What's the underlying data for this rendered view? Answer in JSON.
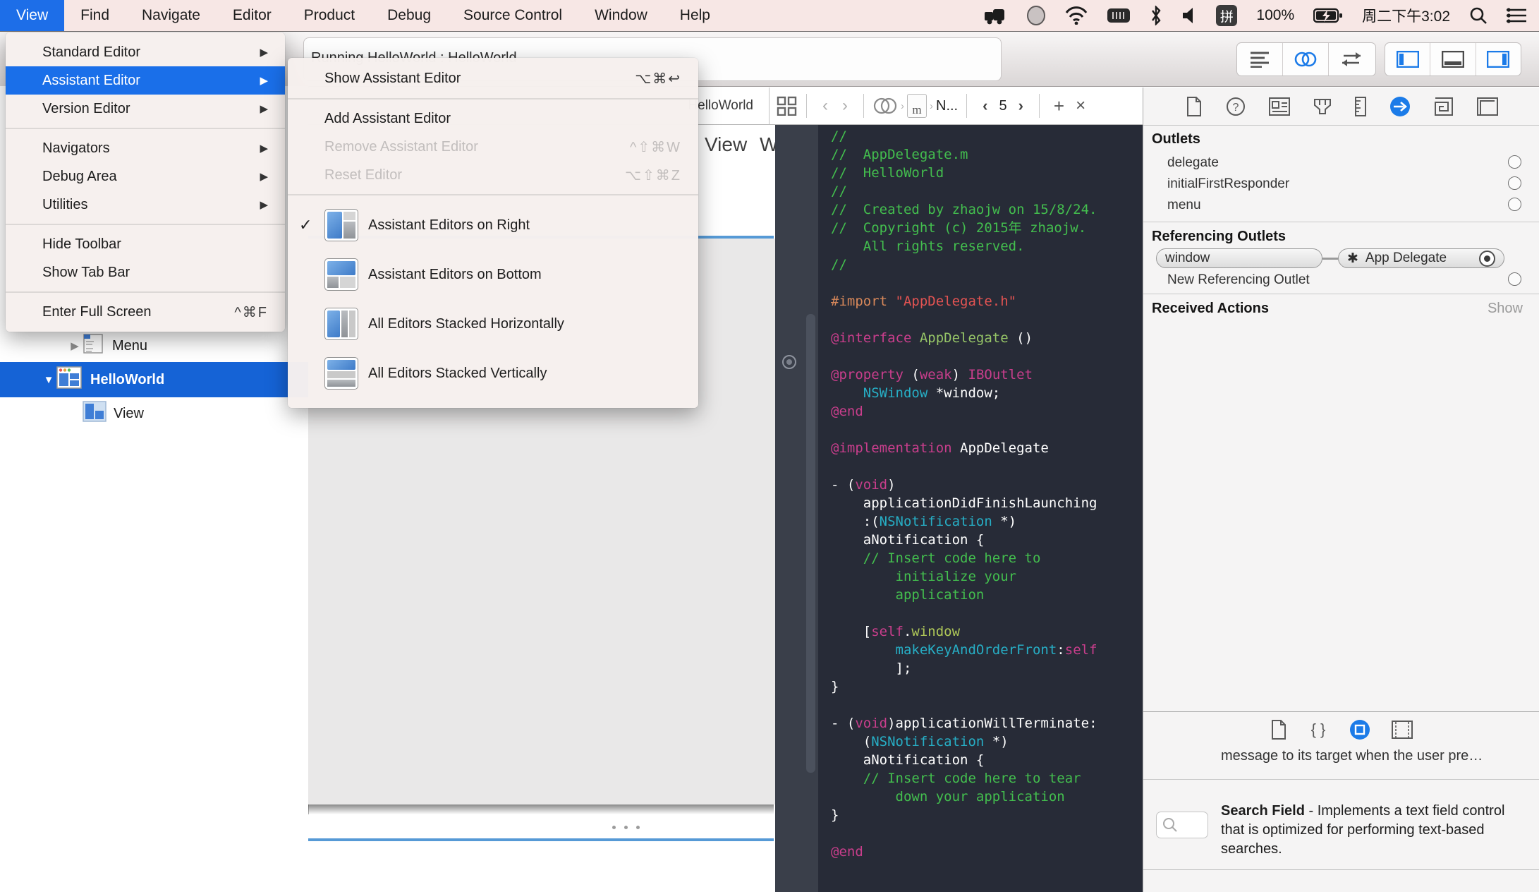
{
  "menubar": {
    "active_menu": "View",
    "menus": [
      "View",
      "Find",
      "Navigate",
      "Editor",
      "Product",
      "Debug",
      "Source Control",
      "Window",
      "Help"
    ],
    "status": {
      "input_method": "拼",
      "battery_percent": "100%",
      "clock": "周二下午3:02"
    }
  },
  "view_menu": {
    "items": [
      {
        "label": "Standard Editor",
        "submenu": true
      },
      {
        "label": "Assistant Editor",
        "submenu": true,
        "highlighted": true
      },
      {
        "label": "Version Editor",
        "submenu": true
      },
      {
        "sep": true
      },
      {
        "label": "Navigators",
        "submenu": true
      },
      {
        "label": "Debug Area",
        "submenu": true
      },
      {
        "label": "Utilities",
        "submenu": true
      },
      {
        "sep": true
      },
      {
        "label": "Hide Toolbar"
      },
      {
        "label": "Show Tab Bar"
      },
      {
        "sep": true
      },
      {
        "label": "Enter Full Screen",
        "shortcut": "^⌘F"
      }
    ]
  },
  "assistant_submenu": {
    "items": [
      {
        "label": "Show Assistant Editor",
        "shortcut": "⌥⌘↩"
      },
      {
        "sep": true
      },
      {
        "label": "Add Assistant Editor"
      },
      {
        "label": "Remove Assistant Editor",
        "shortcut": "^⇧⌘W",
        "disabled": true
      },
      {
        "label": "Reset Editor",
        "shortcut": "⌥⇧⌘Z",
        "disabled": true
      },
      {
        "sep": true
      },
      {
        "label": "Assistant Editors on Right",
        "checked": true,
        "icon": "right"
      },
      {
        "label": "Assistant Editors on Bottom",
        "icon": "bottom"
      },
      {
        "label": "All Editors Stacked Horizontally",
        "icon": "horizontal"
      },
      {
        "label": "All Editors Stacked Vertically",
        "icon": "vertical"
      }
    ]
  },
  "toolbar": {
    "activity_text": "Running HelloWorld : HelloWorld"
  },
  "outline": {
    "rows": [
      {
        "label": "Menu",
        "disclosure": "▶",
        "icon": "menu",
        "indent": 1
      },
      {
        "label": "HelloWorld",
        "disclosure": "▼",
        "icon": "window",
        "selected": true,
        "indent": 0
      },
      {
        "label": "View",
        "disclosure": "",
        "icon": "view",
        "indent": 1
      }
    ]
  },
  "canvas": {
    "header_title": "View",
    "header_partial": "W"
  },
  "primary_jumpbar": {
    "trail": "HelloWorld"
  },
  "assistant_jumpbar": {
    "file_badge": "m",
    "trail": "N...",
    "counter": "5"
  },
  "code_editor": {
    "lines": [
      [
        [
          "cm",
          "//"
        ]
      ],
      [
        [
          "cm",
          "//  AppDelegate.m"
        ]
      ],
      [
        [
          "cm",
          "//  HelloWorld"
        ]
      ],
      [
        [
          "cm",
          "//"
        ]
      ],
      [
        [
          "cm",
          "//  Created by zhaojw on 15/8/24."
        ]
      ],
      [
        [
          "cm",
          "//  Copyright (c) 2015年 zhaojw."
        ]
      ],
      [
        [
          "cm",
          "    All rights reserved."
        ]
      ],
      [
        [
          "cm",
          "//"
        ]
      ],
      [],
      [
        [
          "pp",
          "#import"
        ],
        [
          "pl",
          " "
        ],
        [
          "st",
          "\"AppDelegate.h\""
        ]
      ],
      [],
      [
        [
          "kw",
          "@interface"
        ],
        [
          "pl",
          " "
        ],
        [
          "cls",
          "AppDelegate"
        ],
        [
          "pl",
          " ()"
        ]
      ],
      [],
      [
        [
          "kw",
          "@property"
        ],
        [
          "pl",
          " ("
        ],
        [
          "kw",
          "weak"
        ],
        [
          "pl",
          ") "
        ],
        [
          "kw",
          "IBOutlet"
        ]
      ],
      [
        [
          "pl",
          "    "
        ],
        [
          "ty",
          "NSWindow"
        ],
        [
          "pl",
          " *window;"
        ]
      ],
      [
        [
          "kw",
          "@end"
        ]
      ],
      [],
      [
        [
          "kw",
          "@implementation"
        ],
        [
          "pl",
          " AppDelegate"
        ]
      ],
      [],
      [
        [
          "pl",
          "- ("
        ],
        [
          "kw",
          "void"
        ],
        [
          "pl",
          ")"
        ]
      ],
      [
        [
          "pl",
          "    applicationDidFinishLaunching"
        ]
      ],
      [
        [
          "pl",
          "    :("
        ],
        [
          "ty",
          "NSNotification"
        ],
        [
          "pl",
          " *)"
        ]
      ],
      [
        [
          "pl",
          "    aNotification {"
        ]
      ],
      [
        [
          "cm",
          "    // Insert code here to"
        ]
      ],
      [
        [
          "cm",
          "        initialize your"
        ]
      ],
      [
        [
          "cm",
          "        application"
        ]
      ],
      [],
      [
        [
          "pl",
          "    ["
        ],
        [
          "kw",
          "self"
        ],
        [
          "pl",
          "."
        ],
        [
          "pr",
          "window"
        ]
      ],
      [
        [
          "pl",
          "        "
        ],
        [
          "ty",
          "makeKeyAndOrderFront"
        ],
        [
          "pl",
          ":"
        ],
        [
          "kw",
          "self"
        ]
      ],
      [
        [
          "pl",
          "        ];"
        ]
      ],
      [
        [
          "pl",
          "}"
        ]
      ],
      [],
      [
        [
          "pl",
          "- ("
        ],
        [
          "kw",
          "void"
        ],
        [
          "pl",
          ")applicationWillTerminate:"
        ]
      ],
      [
        [
          "pl",
          "    ("
        ],
        [
          "ty",
          "NSNotification"
        ],
        [
          "pl",
          " *)"
        ]
      ],
      [
        [
          "pl",
          "    aNotification {"
        ]
      ],
      [
        [
          "cm",
          "    // Insert code here to tear"
        ]
      ],
      [
        [
          "cm",
          "        down your application"
        ]
      ],
      [
        [
          "pl",
          "}"
        ]
      ],
      [],
      [
        [
          "kw",
          "@end"
        ]
      ]
    ]
  },
  "inspector": {
    "outlets_header": "Outlets",
    "outlets": [
      "delegate",
      "initialFirstResponder",
      "menu"
    ],
    "referencing_header": "Referencing Outlets",
    "connection": {
      "source": "window",
      "target": "App Delegate",
      "target_glyph": "✱"
    },
    "new_referencing_label": "New Referencing Outlet",
    "received_header": "Received Actions",
    "show_label": "Show"
  },
  "library": {
    "snippet_text": "message to its target when the user pre…",
    "item_title": "Search Field",
    "item_desc": " - Implements a text field control that is optimized for performing text-based searches."
  },
  "colors": {
    "accent_blue": "#1a6fe9",
    "selection_blue": "#1563d6",
    "code_bg": "#272b37"
  }
}
